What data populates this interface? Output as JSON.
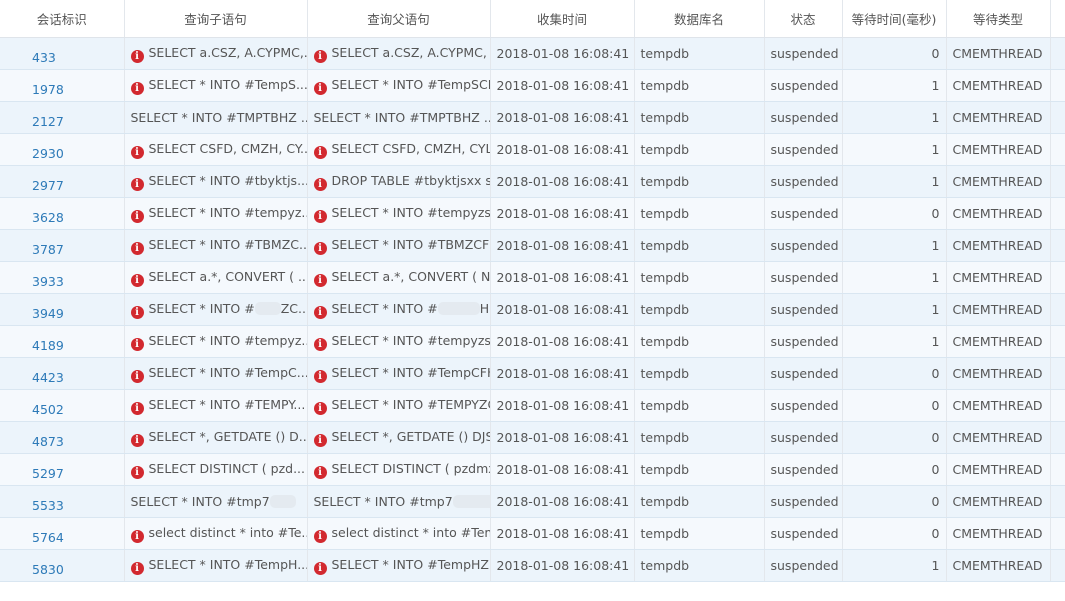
{
  "columns": [
    "会话标识",
    "查询子语句",
    "查询父语句",
    "收集时间",
    "数据库名",
    "状态",
    "等待时间(毫秒)",
    "等待类型"
  ],
  "icon": "error-icon",
  "icon_color": "#d2292f",
  "link_color": "#2d7ab8",
  "rows": [
    {
      "id": "433",
      "error": true,
      "child": "SELECT a.CSZ, A.CYPMC,...",
      "parent": "SELECT a.CSZ, A.CYPMC, a....",
      "time": "2018-01-08 16:08:41",
      "db": "tempdb",
      "status": "suspended",
      "wait": "0",
      "type": "CMEMTHREAD"
    },
    {
      "id": "1978",
      "error": true,
      "child": "SELECT * INTO #TempS...",
      "parent": "SELECT * INTO #TempSCB...",
      "time": "2018-01-08 16:08:41",
      "db": "tempdb",
      "status": "suspended",
      "wait": "1",
      "type": "CMEMTHREAD"
    },
    {
      "id": "2127",
      "error": false,
      "child": "SELECT * INTO #TMPTBHZ ...",
      "parent": "SELECT * INTO #TMPTBHZ ...",
      "time": "2018-01-08 16:08:41",
      "db": "tempdb",
      "status": "suspended",
      "wait": "1",
      "type": "CMEMTHREAD"
    },
    {
      "id": "2930",
      "error": true,
      "child": "SELECT CSFD, CMZH, CY...",
      "parent": "SELECT CSFD, CMZH, CYLH,...",
      "time": "2018-01-08 16:08:41",
      "db": "tempdb",
      "status": "suspended",
      "wait": "1",
      "type": "CMEMTHREAD"
    },
    {
      "id": "2977",
      "error": true,
      "child": "SELECT * INTO #tbyktjs...",
      "parent": "DROP TABLE #tbyktjsxx sel...",
      "time": "2018-01-08 16:08:41",
      "db": "tempdb",
      "status": "suspended",
      "wait": "1",
      "type": "CMEMTHREAD"
    },
    {
      "id": "3628",
      "error": true,
      "child": "SELECT * INTO #tempyz...",
      "parent": "SELECT * INTO #tempyzsq...",
      "time": "2018-01-08 16:08:41",
      "db": "tempdb",
      "status": "suspended",
      "wait": "0",
      "type": "CMEMTHREAD"
    },
    {
      "id": "3787",
      "error": true,
      "child": "SELECT * INTO #TBMZC...",
      "parent": "SELECT * INTO #TBMZCFH...",
      "time": "2018-01-08 16:08:41",
      "db": "tempdb",
      "status": "suspended",
      "wait": "1",
      "type": "CMEMTHREAD"
    },
    {
      "id": "3933",
      "error": true,
      "child": "SELECT a.*, CONVERT ( ...",
      "parent": "SELECT a.*, CONVERT ( NU...",
      "time": "2018-01-08 16:08:41",
      "db": "tempdb",
      "status": "suspended",
      "wait": "1",
      "type": "CMEMTHREAD"
    },
    {
      "id": "3949",
      "error": true,
      "child": "SELECT * INTO #",
      "child_tail": "ZC...",
      "parent": "SELECT * INTO #",
      "parent_tail": "H...",
      "blurred": true,
      "time": "2018-01-08 16:08:41",
      "db": "tempdb",
      "status": "suspended",
      "wait": "1",
      "type": "CMEMTHREAD"
    },
    {
      "id": "4189",
      "error": true,
      "child": "SELECT * INTO #tempyz...",
      "parent": "SELECT * INTO #tempyzsq...",
      "time": "2018-01-08 16:08:41",
      "db": "tempdb",
      "status": "suspended",
      "wait": "1",
      "type": "CMEMTHREAD"
    },
    {
      "id": "4423",
      "error": true,
      "child": "SELECT * INTO #TempC...",
      "parent": "SELECT * INTO #TempCFH...",
      "time": "2018-01-08 16:08:41",
      "db": "tempdb",
      "status": "suspended",
      "wait": "0",
      "type": "CMEMTHREAD"
    },
    {
      "id": "4502",
      "error": true,
      "child": "SELECT * INTO #TEMPY...",
      "parent": "SELECT * INTO #TEMPYZCF...",
      "time": "2018-01-08 16:08:41",
      "db": "tempdb",
      "status": "suspended",
      "wait": "0",
      "type": "CMEMTHREAD"
    },
    {
      "id": "4873",
      "error": true,
      "child": "SELECT *, GETDATE () D...",
      "parent": "SELECT *, GETDATE () DJSS...",
      "time": "2018-01-08 16:08:41",
      "db": "tempdb",
      "status": "suspended",
      "wait": "0",
      "type": "CMEMTHREAD"
    },
    {
      "id": "5297",
      "error": true,
      "child": "SELECT DISTINCT ( pzd...",
      "parent": "SELECT DISTINCT ( pzdmx....",
      "time": "2018-01-08 16:08:41",
      "db": "tempdb",
      "status": "suspended",
      "wait": "0",
      "type": "CMEMTHREAD"
    },
    {
      "id": "5533",
      "error": false,
      "child": "SELECT * INTO #tmp7",
      "child_tail": "",
      "parent": "SELECT * INTO #tmp7",
      "parent_tail": "...",
      "blurred": true,
      "time": "2018-01-08 16:08:41",
      "db": "tempdb",
      "status": "suspended",
      "wait": "0",
      "type": "CMEMTHREAD"
    },
    {
      "id": "5764",
      "error": true,
      "child": "select distinct * into #Te...",
      "parent": "select distinct * into #Temp...",
      "time": "2018-01-08 16:08:41",
      "db": "tempdb",
      "status": "suspended",
      "wait": "0",
      "type": "CMEMTHREAD"
    },
    {
      "id": "5830",
      "error": true,
      "child": "SELECT * INTO #TempH...",
      "parent": "SELECT * INTO #TempHZ f...",
      "time": "2018-01-08 16:08:41",
      "db": "tempdb",
      "status": "suspended",
      "wait": "1",
      "type": "CMEMTHREAD"
    }
  ]
}
